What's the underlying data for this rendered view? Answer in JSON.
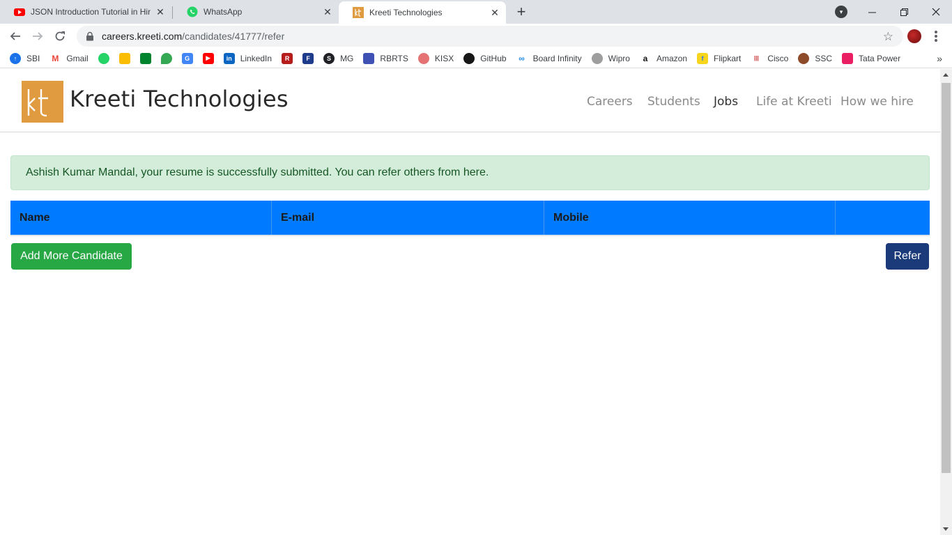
{
  "browser": {
    "tabs": [
      {
        "title": "JSON Introduction Tutorial in Hindi",
        "icon": "youtube-icon",
        "active": false
      },
      {
        "title": "WhatsApp",
        "icon": "whatsapp-icon",
        "active": false
      },
      {
        "title": "Kreeti Technologies",
        "icon": "kreeti-favicon",
        "active": true
      }
    ],
    "new_tab": "+",
    "url_host": "careers.kreeti.com",
    "url_path": "/candidates/41777/refer",
    "bookmarks": [
      "SBI",
      "Gmail",
      "LinkedIn",
      "MG",
      "RBRTS",
      "KISX",
      "GitHub",
      "Board Infinity",
      "Wipro",
      "Amazon",
      "Flipkart",
      "Cisco",
      "SSC",
      "Tata Power"
    ],
    "more": "»"
  },
  "site": {
    "logo_mark": "kt",
    "logo_text": "Kreeti Technologies",
    "nav": [
      "Careers",
      "Students",
      "Jobs",
      "Life at Kreeti",
      "How we hire"
    ],
    "active_nav": "Jobs",
    "accent_color": "#e09a3f"
  },
  "alert": {
    "message": "Ashish Kumar Mandal, your resume is successfully submitted. You can refer others from here.",
    "color": "#d4edda"
  },
  "table": {
    "headers": [
      "Name",
      "E-mail",
      "Mobile",
      ""
    ],
    "header_color": "#007bff"
  },
  "actions": {
    "add_label": "Add More Candidate",
    "refer_label": "Refer"
  }
}
